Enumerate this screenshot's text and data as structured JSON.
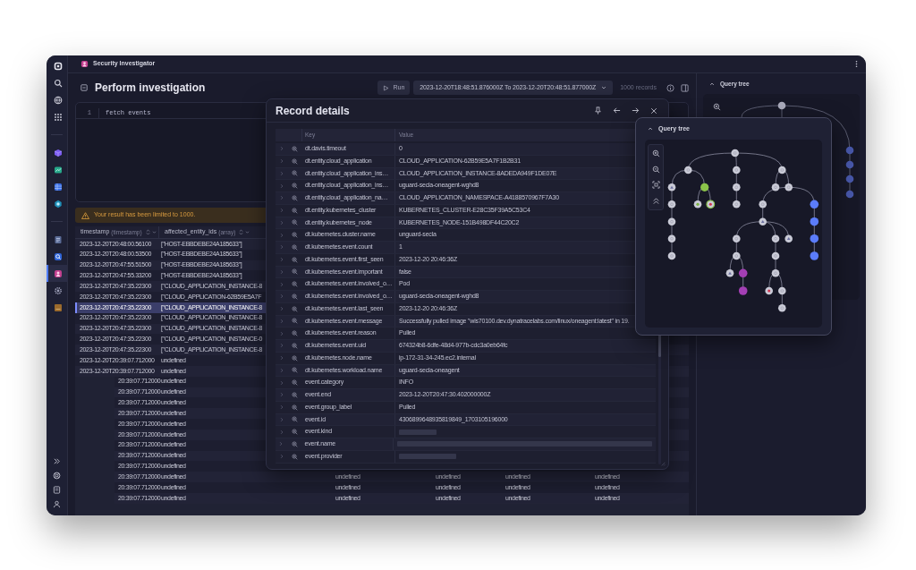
{
  "app": {
    "title": "Security Investigator"
  },
  "sidebar": {
    "items": [
      {
        "kind": "logo",
        "selected": false
      },
      {
        "kind": "search",
        "selected": false
      },
      {
        "kind": "globe",
        "selected": false
      },
      {
        "kind": "apps",
        "selected": false
      },
      {
        "kind": "separator"
      },
      {
        "kind": "cube",
        "selected": false
      },
      {
        "kind": "chart",
        "selected": false
      },
      {
        "kind": "table",
        "selected": false
      },
      {
        "kind": "hexagon",
        "selected": false
      },
      {
        "kind": "separator"
      },
      {
        "kind": "document",
        "selected": false
      },
      {
        "kind": "magnifier",
        "selected": false
      },
      {
        "kind": "person",
        "selected": true
      },
      {
        "kind": "gear",
        "selected": false
      },
      {
        "kind": "folder",
        "selected": false
      }
    ],
    "bottom_items": [
      {
        "kind": "expand"
      },
      {
        "kind": "lifebuoy"
      },
      {
        "kind": "notebook"
      },
      {
        "kind": "user"
      }
    ]
  },
  "page": {
    "title": "Perform investigation"
  },
  "toolbar": {
    "run": "Run",
    "timeframe": "2023-12-20T18:48:51.876000Z To 2023-12-20T20:48:51.877000Z",
    "records": "1000 records"
  },
  "editor": {
    "lines": [
      {
        "number": "1",
        "code": "fetch events"
      }
    ]
  },
  "warning": "Your result has been limited to 1000.",
  "table": {
    "columns": [
      {
        "name": "timestamp",
        "type": "(timestamp)"
      },
      {
        "name": "affected_entity_ids",
        "type": "(array)"
      }
    ],
    "rows": [
      {
        "kind": "full",
        "selected": false,
        "cells": [
          "2023-12-20T20:48:00.56100",
          "[\"HOST-EBBDEBE24A185633\"]"
        ]
      },
      {
        "kind": "full",
        "selected": false,
        "cells": [
          "2023-12-20T20:48:00.53500",
          "[\"HOST-EBBDEBE24A185633\"]"
        ]
      },
      {
        "kind": "full",
        "selected": false,
        "cells": [
          "2023-12-20T20:47:55.51500",
          "[\"HOST-EBBDEBE24A185633\"]"
        ]
      },
      {
        "kind": "full",
        "selected": false,
        "cells": [
          "2023-12-20T20:47:55.33200",
          "[\"HOST-EBBDEBE24A185633\"]"
        ]
      },
      {
        "kind": "full",
        "selected": false,
        "cells": [
          "2023-12-20T20:47:35.22300",
          "[\"CLOUD_APPLICATION_INSTANCE-8"
        ]
      },
      {
        "kind": "full",
        "selected": false,
        "cells": [
          "2023-12-20T20:47:35.22300",
          "[\"CLOUD_APPLICATION-62B59E5A7F"
        ]
      },
      {
        "kind": "full",
        "selected": true,
        "cells": [
          "2023-12-20T20:47:35.22300",
          "[\"CLOUD_APPLICATION_INSTANCE-8"
        ]
      },
      {
        "kind": "full",
        "selected": false,
        "cells": [
          "2023-12-20T20:47:35.22300",
          "[\"CLOUD_APPLICATION_INSTANCE-8"
        ]
      },
      {
        "kind": "full",
        "selected": false,
        "cells": [
          "2023-12-20T20:47:35.22300",
          "[\"CLOUD_APPLICATION_INSTANCE-8"
        ]
      },
      {
        "kind": "full",
        "selected": false,
        "cells": [
          "2023-12-20T20:47:35.22300",
          "[\"CLOUD_APPLICATION_INSTANCE-0"
        ]
      },
      {
        "kind": "full",
        "selected": false,
        "cells": [
          "2023-12-20T20:47:35.22300",
          "[\"CLOUD_APPLICATION_INSTANCE-8"
        ]
      },
      {
        "kind": "full",
        "selected": false,
        "cells": [
          "2023-12-20T20:39:07.712000",
          "undefined"
        ]
      },
      {
        "kind": "full",
        "selected": false,
        "cells": [
          "2023-12-20T20:39:07.712000",
          "undefined"
        ]
      },
      {
        "kind": "partial",
        "selected": false,
        "cells": [
          "20:39:07.712000",
          "undefined"
        ]
      },
      {
        "kind": "partial",
        "selected": false,
        "cells": [
          "20:39:07.712000",
          "undefined"
        ]
      },
      {
        "kind": "partial",
        "selected": false,
        "cells": [
          "20:39:07.712000",
          "undefined"
        ]
      },
      {
        "kind": "partial",
        "selected": false,
        "cells": [
          "20:39:07.712000",
          "undefined"
        ]
      },
      {
        "kind": "partial",
        "selected": false,
        "cells": [
          "20:39:07.712000",
          "undefined"
        ]
      },
      {
        "kind": "partial",
        "selected": false,
        "cells": [
          "20:39:07.712000",
          "undefined"
        ]
      },
      {
        "kind": "partial",
        "selected": false,
        "cells": [
          "20:39:07.712000",
          "undefined"
        ]
      },
      {
        "kind": "partial",
        "selected": false,
        "cells": [
          "20:39:07.712000",
          "undefined"
        ]
      },
      {
        "kind": "partial",
        "selected": false,
        "cells": [
          "20:39:07.712000",
          "undefined"
        ]
      },
      {
        "kind": "partial",
        "selected": false,
        "cells": [
          "20:39:07.712000",
          "undefined",
          "undefined",
          "undefined",
          "undefined",
          "undefined"
        ]
      },
      {
        "kind": "partial",
        "selected": false,
        "cells": [
          "20:39:07.712000",
          "undefined",
          "undefined",
          "undefined",
          "undefined",
          "undefined"
        ]
      },
      {
        "kind": "partial",
        "selected": false,
        "cells": [
          "20:39:07.712000",
          "undefined",
          "undefined",
          "undefined",
          "undefined",
          "undefined"
        ]
      }
    ]
  },
  "record_details": {
    "title": "Record details",
    "columns": [
      "Key",
      "Value"
    ],
    "rows": [
      {
        "kind": "value",
        "key": "dt.davis.timeout",
        "value": "0"
      },
      {
        "kind": "value",
        "key": "dt.entity.cloud_application",
        "value": "CLOUD_APPLICATION-62B59E5A7F1B2B31"
      },
      {
        "kind": "value",
        "key": "dt.entity.cloud_application_ins…",
        "value": "CLOUD_APPLICATION_INSTANCE-8ADEDA949F1DE07E"
      },
      {
        "kind": "value",
        "key": "dt.entity.cloud_application_ins…",
        "value": "uguard-secla-oneagent-wghd8"
      },
      {
        "kind": "value",
        "key": "dt.entity.cloud_application_na…",
        "value": "CLOUD_APPLICATION_NAMESPACE-A4188570967F7A30"
      },
      {
        "kind": "value",
        "key": "dt.entity.kubernetes_cluster",
        "value": "KUBERNETES_CLUSTER-E28C35F39A5C53C4"
      },
      {
        "kind": "value",
        "key": "dt.entity.kubernetes_node",
        "value": "KUBERNETES_NODE-151B498DF44C20C2"
      },
      {
        "kind": "value",
        "key": "dt.kubernetes.cluster.name",
        "value": "unguard-secla"
      },
      {
        "kind": "value",
        "key": "dt.kubernetes.event.count",
        "value": "1"
      },
      {
        "kind": "value",
        "key": "dt.kubernetes.event.first_seen",
        "value": "2023-12-20 20:46:36Z"
      },
      {
        "kind": "value",
        "key": "dt.kubernetes.event.important",
        "value": "false"
      },
      {
        "kind": "value",
        "key": "dt.kubernetes.event.involved_o…",
        "value": "Pod"
      },
      {
        "kind": "value",
        "key": "dt.kubernetes.event.involved_o…",
        "value": "uguard-secla-oneagent-wghd8"
      },
      {
        "kind": "value",
        "key": "dt.kubernetes.event.last_seen",
        "value": "2023-12-20 20:46:36Z"
      },
      {
        "kind": "value",
        "key": "dt.kubernetes.event.message",
        "value": "Successfully pulled image \"wis70100.dev.dynatracelabs.com/linux/oneagent:latest\" in 19."
      },
      {
        "kind": "value",
        "key": "dt.kubernetes.event.reason",
        "value": "Pulled"
      },
      {
        "kind": "value",
        "key": "dt.kubernetes.event.uid",
        "value": "674324b8-6dfe-48d4-977b-cdc3a0eb64fc"
      },
      {
        "kind": "value",
        "key": "dt.kubernetes.node.name",
        "value": "ip-172-31-34-245.ec2.internal"
      },
      {
        "kind": "value",
        "key": "dt.kubernetes.workload.name",
        "value": "uguard-secla-oneagent"
      },
      {
        "kind": "value",
        "key": "event.category",
        "value": "INFO"
      },
      {
        "kind": "value",
        "key": "event.end",
        "value": "2023-12-20T20:47:30.402000000Z"
      },
      {
        "kind": "value",
        "key": "event.group_label",
        "value": "Pulled"
      },
      {
        "kind": "value",
        "key": "event.id",
        "value": "4306899648935819849_1703105196000"
      },
      {
        "kind": "skeleton",
        "key": "event.kind"
      },
      {
        "kind": "skeleton",
        "key": "event.name"
      },
      {
        "kind": "skeleton",
        "key": "event.provider"
      }
    ]
  },
  "query_tree_popup": {
    "title": "Query tree"
  },
  "query_tree_panel": {
    "title": "Query tree"
  }
}
